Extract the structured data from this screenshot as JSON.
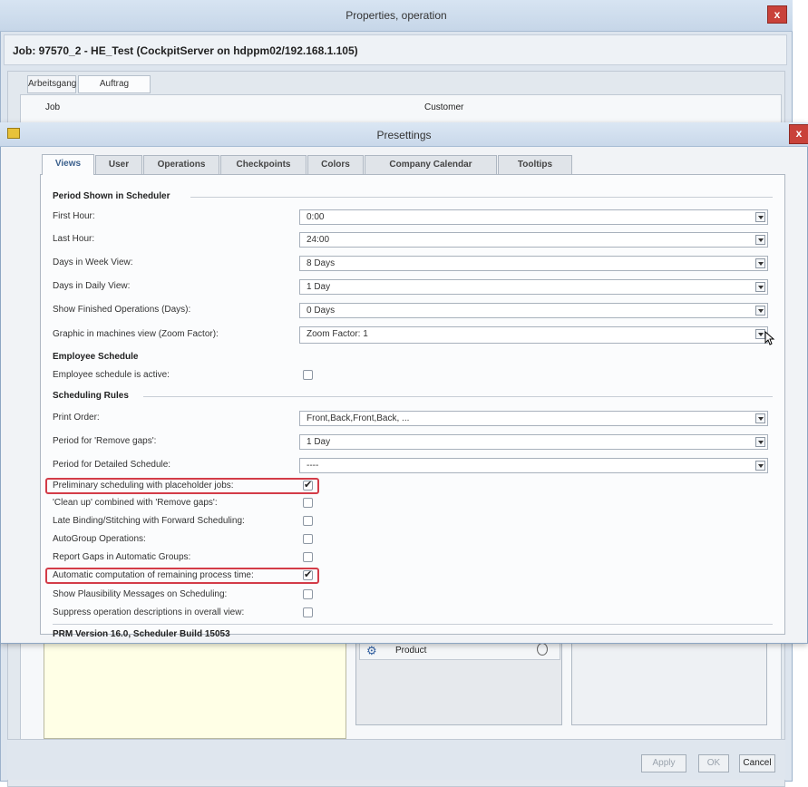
{
  "background_window": {
    "title": "Properties, operation",
    "close_label": "x",
    "job_line": "Job: 97570_2 - HE_Test (CockpitServer on hdppm02/192.168.1.105)",
    "tabs": [
      "Arbeitsgang",
      "Auftrag"
    ],
    "labels": {
      "job": "Job",
      "customer": "Customer"
    },
    "product_label": "Product",
    "buttons": {
      "apply": "Apply",
      "ok": "OK",
      "cancel": "Cancel"
    }
  },
  "dialog": {
    "title": "Presettings",
    "close_label": "x",
    "tabs": [
      "Views",
      "User",
      "Operations",
      "Checkpoints",
      "Colors",
      "Company Calendar",
      "Tooltips"
    ],
    "active_tab": "Views",
    "sections": {
      "period": "Period Shown in Scheduler",
      "employee": "Employee Schedule",
      "rules": "Scheduling Rules"
    },
    "period_rows": [
      {
        "label": "First Hour:",
        "value": "0:00"
      },
      {
        "label": "Last Hour:",
        "value": "24:00"
      },
      {
        "label": "Days in Week View:",
        "value": "8 Days"
      },
      {
        "label": "Days in Daily View:",
        "value": "1 Day"
      },
      {
        "label": "Show Finished Operations (Days):",
        "value": "0 Days"
      },
      {
        "label": "Graphic in machines view (Zoom Factor):",
        "value": "Zoom Factor: 1"
      }
    ],
    "employee_rows": [
      {
        "label": "Employee schedule is active:",
        "checked": false
      }
    ],
    "rules_selects": [
      {
        "label": "Print Order:",
        "value": "Front,Back,Front,Back, ..."
      },
      {
        "label": "Period for 'Remove gaps':",
        "value": "1 Day"
      },
      {
        "label": "Period for Detailed Schedule:",
        "value": "----"
      }
    ],
    "rules_checks": [
      {
        "label": "Preliminary scheduling with placeholder jobs:",
        "checked": true,
        "highlighted": true
      },
      {
        "label": "'Clean up' combined with 'Remove gaps':",
        "checked": false,
        "highlighted": false
      },
      {
        "label": "Late Binding/Stitching with Forward Scheduling:",
        "checked": false,
        "highlighted": false
      },
      {
        "label": "AutoGroup Operations:",
        "checked": false,
        "highlighted": false
      },
      {
        "label": "Report Gaps in Automatic Groups:",
        "checked": false,
        "highlighted": false
      },
      {
        "label": "Automatic computation of remaining process time:",
        "checked": true,
        "highlighted": true
      },
      {
        "label": "Show Plausibility Messages on Scheduling:",
        "checked": false,
        "highlighted": false
      },
      {
        "label": "Suppress operation descriptions in overall view:",
        "checked": false,
        "highlighted": false
      }
    ],
    "version": "PRM Version 16.0, Scheduler Build 15053"
  },
  "colors": {
    "accent_red": "#d33c48",
    "close_red": "#c9423a",
    "title_blue": "#c9d8ea"
  }
}
